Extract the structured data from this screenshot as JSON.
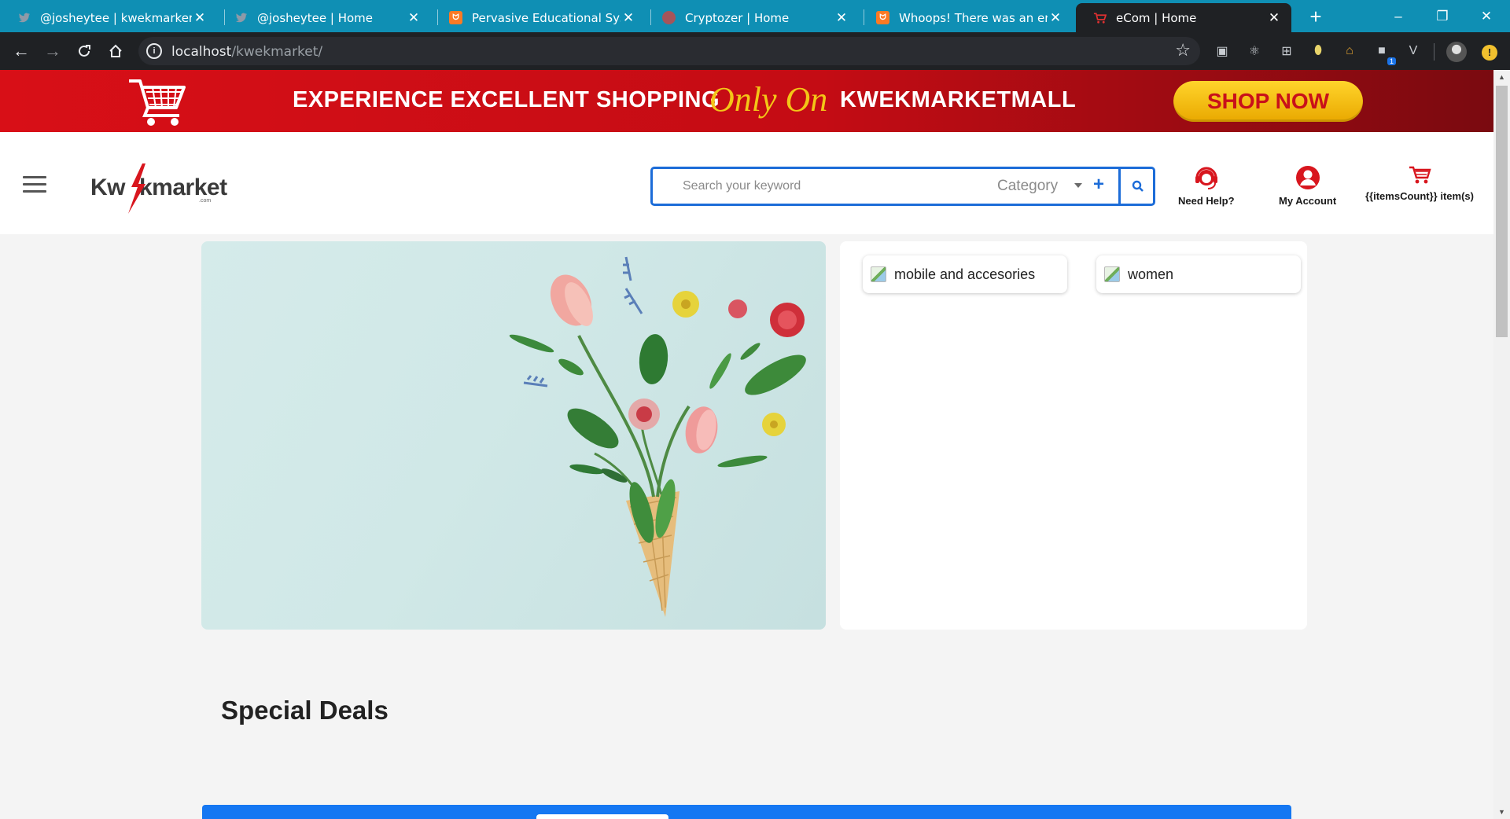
{
  "browser": {
    "tabs": [
      {
        "title": "@josheytee | kwekmarkert",
        "favicon": "twitter-icon"
      },
      {
        "title": "@josheytee | Home",
        "favicon": "twitter-icon"
      },
      {
        "title": "Pervasive Educational System",
        "favicon": "xampp-icon"
      },
      {
        "title": "Cryptozer | Home",
        "favicon": "globe-icon"
      },
      {
        "title": "Whoops! There was an error.",
        "favicon": "xampp-icon"
      },
      {
        "title": "eCom | Home",
        "favicon": "cart-icon",
        "active": true
      }
    ],
    "url_host": "localhost",
    "url_path": "/kwekmarket/",
    "extension_badge": "1",
    "colors": {
      "tabbar": "#0f8fb4",
      "toolbar": "#1f2124"
    }
  },
  "promo": {
    "headline": "EXPERIENCE EXCELLENT SHOPPING",
    "tagline": "Only On",
    "brand": "KWEKMARKETMALL",
    "cta": "SHOP NOW",
    "colors": {
      "background": "#d80f17",
      "cta": "#f3c617"
    }
  },
  "header": {
    "logo_text_left": "Kw",
    "logo_text_right": "kmarket",
    "logo_suffix": ".com",
    "search": {
      "placeholder": "Search your keyword",
      "value": "",
      "category": "Category"
    },
    "need_help": "Need Help?",
    "my_account": "My Account",
    "cart": "{{itemsCount}} item(s)",
    "accent": "#1c6cd8"
  },
  "categories": [
    {
      "label": "mobile and accesories"
    },
    {
      "label": "women"
    }
  ],
  "deals": {
    "title": "Special Deals",
    "bar_color": "#1577f2"
  }
}
